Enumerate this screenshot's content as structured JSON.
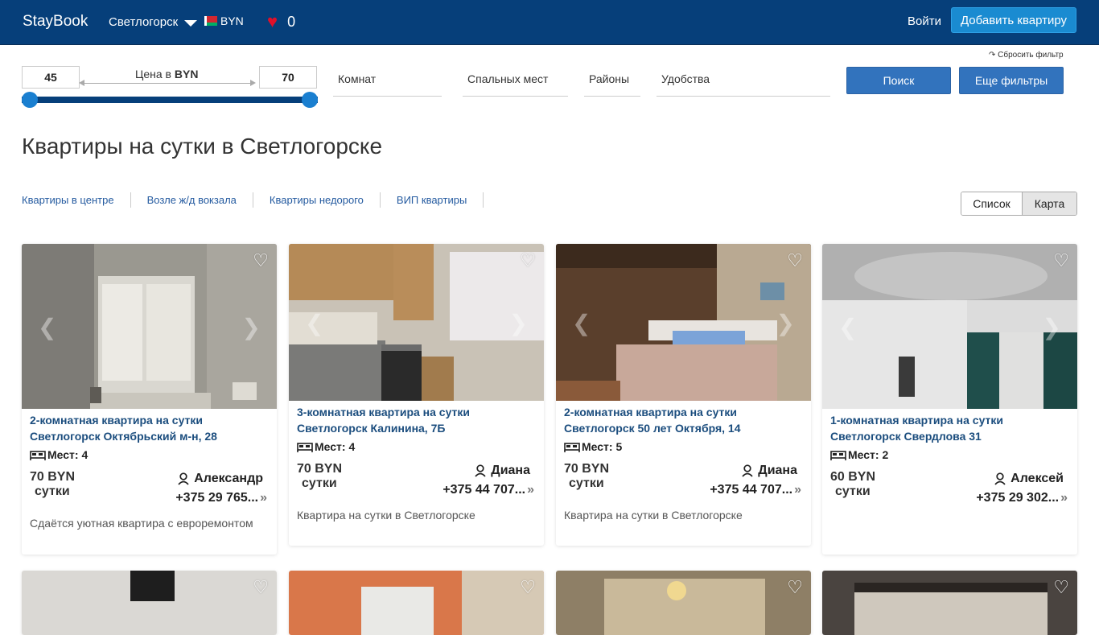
{
  "header": {
    "brand": "StayBook",
    "city": "Светлогорск",
    "currency": "BYN",
    "favorites_count": "0",
    "login": "Войти",
    "add_apartment": "Добавить квартиру"
  },
  "filters": {
    "price_min": "45",
    "price_max": "70",
    "price_label": "Цена в",
    "price_currency": "BYN",
    "price_range_fraction": [
      0.0,
      1.0
    ],
    "rooms": "Комнат",
    "sleeping_places": "Спальных мест",
    "districts": "Районы",
    "amenities": "Удобства",
    "reset": "↷ Сбросить фильтр",
    "search": "Поиск",
    "more_filters": "Еще фильтры"
  },
  "page_title": "Квартиры на сутки в Светлогорске",
  "quick_links": [
    "Квартиры в центре",
    "Возле ж/д вокзала",
    "Квартиры недорого",
    "ВИП квартиры"
  ],
  "view_toggle": {
    "list": "Список",
    "map": "Карта"
  },
  "listings": [
    {
      "title_line1": "2-комнатная квартира на сутки",
      "title_line2": "Светлогорск Октябрьский м-н, 28",
      "places": "Мест: 4",
      "price": "70 BYN",
      "per": "сутки",
      "owner": "Александр",
      "phone": "+375 29 765...",
      "description": "Сдаётся уютная квартира с евроремонтом"
    },
    {
      "title_line1": "3-комнатная квартира на сутки",
      "title_line2": "Светлогорск Калинина, 7Б",
      "places": "Мест: 4",
      "price": "70 BYN",
      "per": "сутки",
      "owner": "Диана",
      "phone": "+375 44 707...",
      "description": "Квартира на сутки в Светлогорске"
    },
    {
      "title_line1": "2-комнатная квартира на сутки",
      "title_line2": "Светлогорск 50 лет Октября, 14",
      "places": "Мест: 5",
      "price": "70 BYN",
      "per": "сутки",
      "owner": "Диана",
      "phone": "+375 44 707...",
      "description": "Квартира на сутки в Светлогорске"
    },
    {
      "title_line1": "1-комнатная квартира на сутки",
      "title_line2": "Светлогорск Свердлова 31",
      "places": "Мест: 2",
      "price": "60 BYN",
      "per": "сутки",
      "owner": "Алексей",
      "phone": "+375 29 302...",
      "description": ""
    }
  ],
  "icons": {
    "favorites": "heart-icon",
    "like": "heart-outline-icon",
    "places": "bed-icon",
    "owner": "user-icon",
    "phone_more": "chevron-double-right-icon",
    "dropdown": "caret-down-icon",
    "flag": "belarus-flag-icon"
  },
  "colors": {
    "header_bg": "#063f7a",
    "accent": "#1a8bd1",
    "button": "#3273bd",
    "link": "#1b4d7e",
    "heart": "#e0102a"
  }
}
